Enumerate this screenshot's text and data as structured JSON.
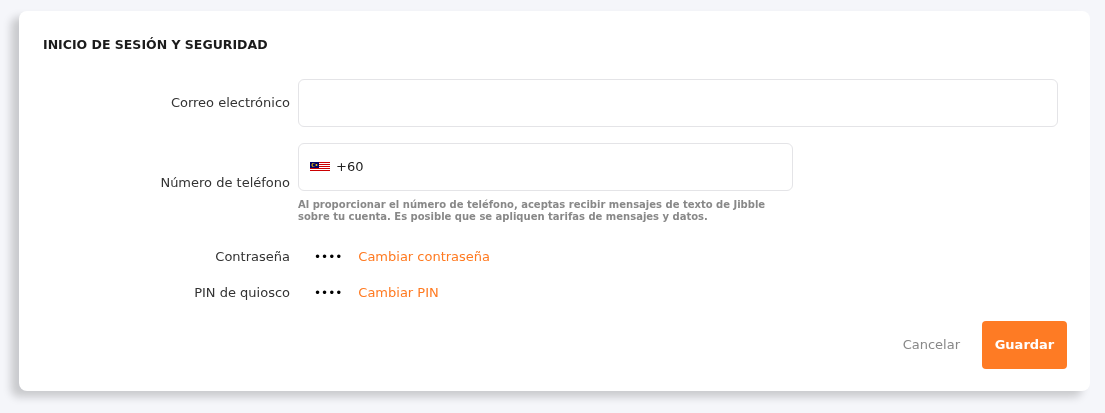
{
  "section": {
    "title": "INICIO DE SESIÓN Y SEGURIDAD"
  },
  "email": {
    "label": "Correo electrónico"
  },
  "phone": {
    "label": "Número de teléfono",
    "value": "+60",
    "hint": "Al proporcionar el número de teléfono, aceptas recibir mensajes de texto de Jibble sobre tu cuenta. Es posible que se apliquen tarifas de mensajes y datos."
  },
  "secrets": [
    {
      "label": "Contraseña",
      "value": "••••",
      "link": "Cambiar contraseña"
    },
    {
      "label": "PIN de quiosco",
      "value": "••••",
      "link": "Cambiar PIN"
    }
  ],
  "buttons": {
    "cancel": "Cancelar",
    "save": "Guardar"
  }
}
